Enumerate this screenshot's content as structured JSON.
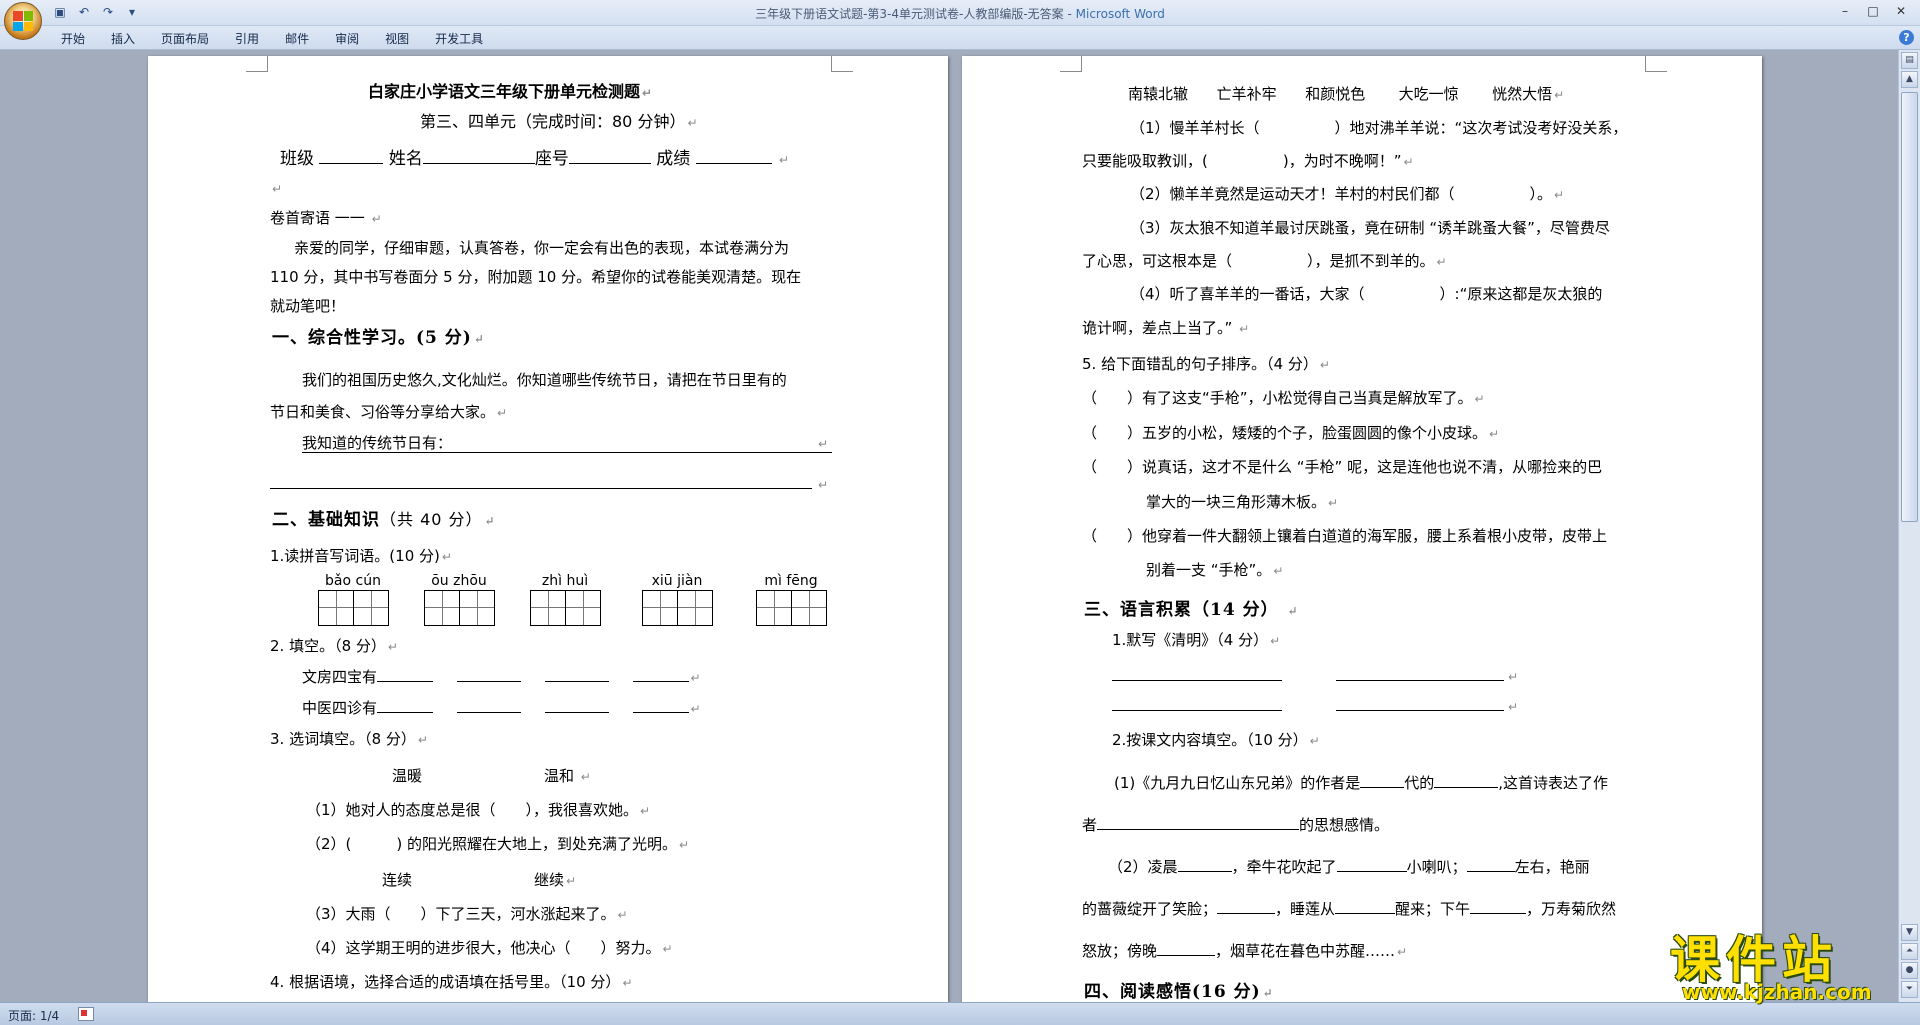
{
  "titlebar": {
    "doc": "三年级下册语文试题-第3-4单元测试卷-人教部编版-无答案",
    "sep": " - ",
    "app": "Microsoft Word"
  },
  "ribbon": {
    "tabs": [
      "开始",
      "插入",
      "页面布局",
      "引用",
      "邮件",
      "审阅",
      "视图",
      "开发工具"
    ]
  },
  "status": {
    "page": "页面: 1/4"
  },
  "watermark": {
    "text": "课件站",
    "url": "www.kjzhan.com"
  },
  "page1": {
    "title": "白家庄小学语文三年级下册单元检测题",
    "subtitle": "第三、四单元（完成时间：80 分钟）",
    "info_labels": [
      "班级",
      "姓名",
      "座号",
      "成绩"
    ],
    "preface_head": "卷首寄语 一一",
    "preface_1": "亲爱的同学，仔细审题，认真答卷，你一定会有出色的表现，本试卷满分为",
    "preface_2": "110 分，其中书写卷面分 5 分，附加题 10 分。希望你的试卷能美观清楚。现在",
    "preface_3": "就动笔吧！",
    "s1_title": "一、综合性学习。(5 分)",
    "s1_p1": "我们的祖国历史悠久,文化灿烂。你知道哪些传统节日，请把在节日里有的",
    "s1_p2": "节日和美食、习俗等分享给大家。",
    "s1_p3": "我知道的传统节日有：",
    "s2_title_main": "二、基础知识",
    "s2_title_sub": "（共 40 分）",
    "q1": "1.读拼音写词语。(10 分)",
    "pinyin": [
      "bǎo cún",
      "ōu zhōu",
      "zhì huì",
      "xiū jiàn",
      "mì fēng"
    ],
    "q2": "2. 填空。（8 分）",
    "q2_a": "文房四宝有",
    "q2_b": "中医四诊有",
    "q3": "3. 选词填空。（8 分）",
    "q3_w1": "温暖",
    "q3_w2": "温和",
    "q3_1": "（1）她对人的态度总是很（　　），我很喜欢她。",
    "q3_2": "（2）(　　　) 的阳光照耀在大地上，到处充满了光明。",
    "q3_w3": "连续",
    "q3_w4": "继续",
    "q3_3": "（3）大雨（　　）下了三天，河水涨起来了。",
    "q3_4": "（4）这学期王明的进步很大，他决心（　　）努力。",
    "q4": "4. 根据语境，选择合适的成语填在括号里。（10 分）"
  },
  "page2": {
    "idioms": [
      "南辕北辙",
      "亡羊补牢",
      "和颜悦色",
      "大吃一惊",
      "恍然大悟"
    ],
    "q4_1a": "（1）慢羊羊村长（　　　　　）地对沸羊羊说：“这次考试没考好没关系，",
    "q4_1b": "只要能吸取教训，(　　　　　)，为时不晚啊！”",
    "q4_2": "（2）懒羊羊竟然是运动天才！羊村的村民们都（　　　　　）。",
    "q4_3a": "（3）灰太狼不知道羊最讨厌跳蚤，竟在研制 “诱羊跳蚤大餐”，尽管费尽",
    "q4_3b": "了心思，可这根本是（　　　　　），是抓不到羊的。",
    "q4_4a": "（4）听了喜羊羊的一番话，大家（　　　　　）:“原来这都是灰太狼的",
    "q4_4b": "诡计啊，差点上当了。”",
    "q5": "5. 给下面错乱的句子排序。（4 分）",
    "q5_1": "（　　）有了这支“手枪”，小松觉得自己当真是解放军了。",
    "q5_2": "（　　）五岁的小松，矮矮的个子，脸蛋圆圆的像个小皮球。",
    "q5_3a": "（　　）说真话，这才不是什么 “手枪” 呢，这是连他也说不清，从哪捡来的巴",
    "q5_3b": "掌大的一块三角形薄木板。",
    "q5_4a": "（　　）他穿着一件大翻领上镶着白道道的海军服，腰上系着根小皮带，皮带上",
    "q5_4b": "别着一支 “手枪”。",
    "s3_title": "三、语言积累（14 分）",
    "s3_q1": "1.默写《清明》（4 分）",
    "s3_q2": "2.按课文内容填空。（10 分）",
    "s3_q2_1a_pre": "(1)《九月九日忆山东兄弟》的作者是",
    "s3_q2_1a_mid": "代的",
    "s3_q2_1a_post": ",这首诗表达了作",
    "s3_q2_1b_pre": "者",
    "s3_q2_1b_post": "的思想感情。",
    "s3_q2_2a_1": "（2）凌晨",
    "s3_q2_2a_2": "，牵牛花吹起了",
    "s3_q2_2a_3": "小喇叭；",
    "s3_q2_2a_4": "左右，艳丽",
    "s3_q2_2b_1": "的蔷薇绽开了笑脸；",
    "s3_q2_2b_2": "，睡莲从",
    "s3_q2_2b_3": "醒来；下午",
    "s3_q2_2b_4": "，万寿菊欣然",
    "s3_q2_2c_1": "怒放；傍晚",
    "s3_q2_2c_2": "，烟草花在暮色中苏醒……",
    "s4_title": "四、阅读感悟(16 分)"
  }
}
